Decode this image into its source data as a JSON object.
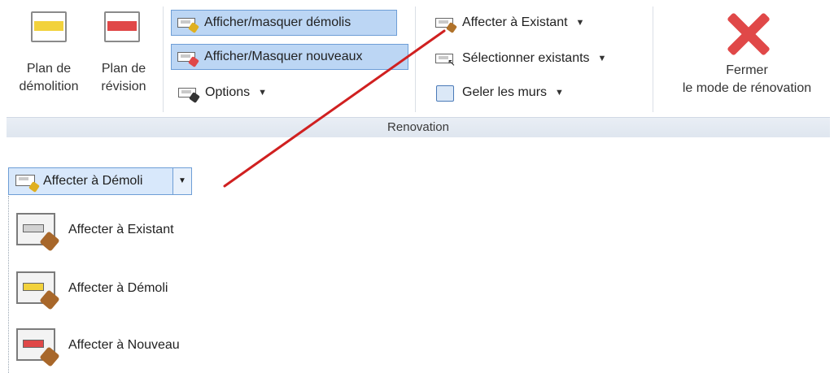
{
  "ribbon": {
    "panel_title": "Renovation",
    "demolition_plan": {
      "line1": "Plan de",
      "line2": "démolition"
    },
    "revision_plan": {
      "line1": "Plan de",
      "line2": "révision"
    },
    "toggle_demolished": "Afficher/masquer démolis",
    "toggle_new": "Afficher/Masquer nouveaux",
    "options": "Options",
    "assign_existing": "Affecter à Existant",
    "select_existing": "Sélectionner existants",
    "freeze_walls": "Geler les murs",
    "close_mode": {
      "line1": "Fermer",
      "line2": "le mode de rénovation"
    }
  },
  "dropdown": {
    "button_label": "Affecter à Démoli",
    "items": [
      {
        "label": "Affecter à Existant",
        "icon": "assign-existing-icon"
      },
      {
        "label": "Affecter à Démoli",
        "icon": "assign-demolished-icon"
      },
      {
        "label": "Affecter à Nouveau",
        "icon": "assign-new-icon"
      }
    ]
  },
  "colors": {
    "demolition_band": "#f2d23c",
    "revision_band": "#e04848",
    "existing_band": "#d2d2d2",
    "highlight": "#bcd6f4",
    "arrow": "#d02020"
  }
}
